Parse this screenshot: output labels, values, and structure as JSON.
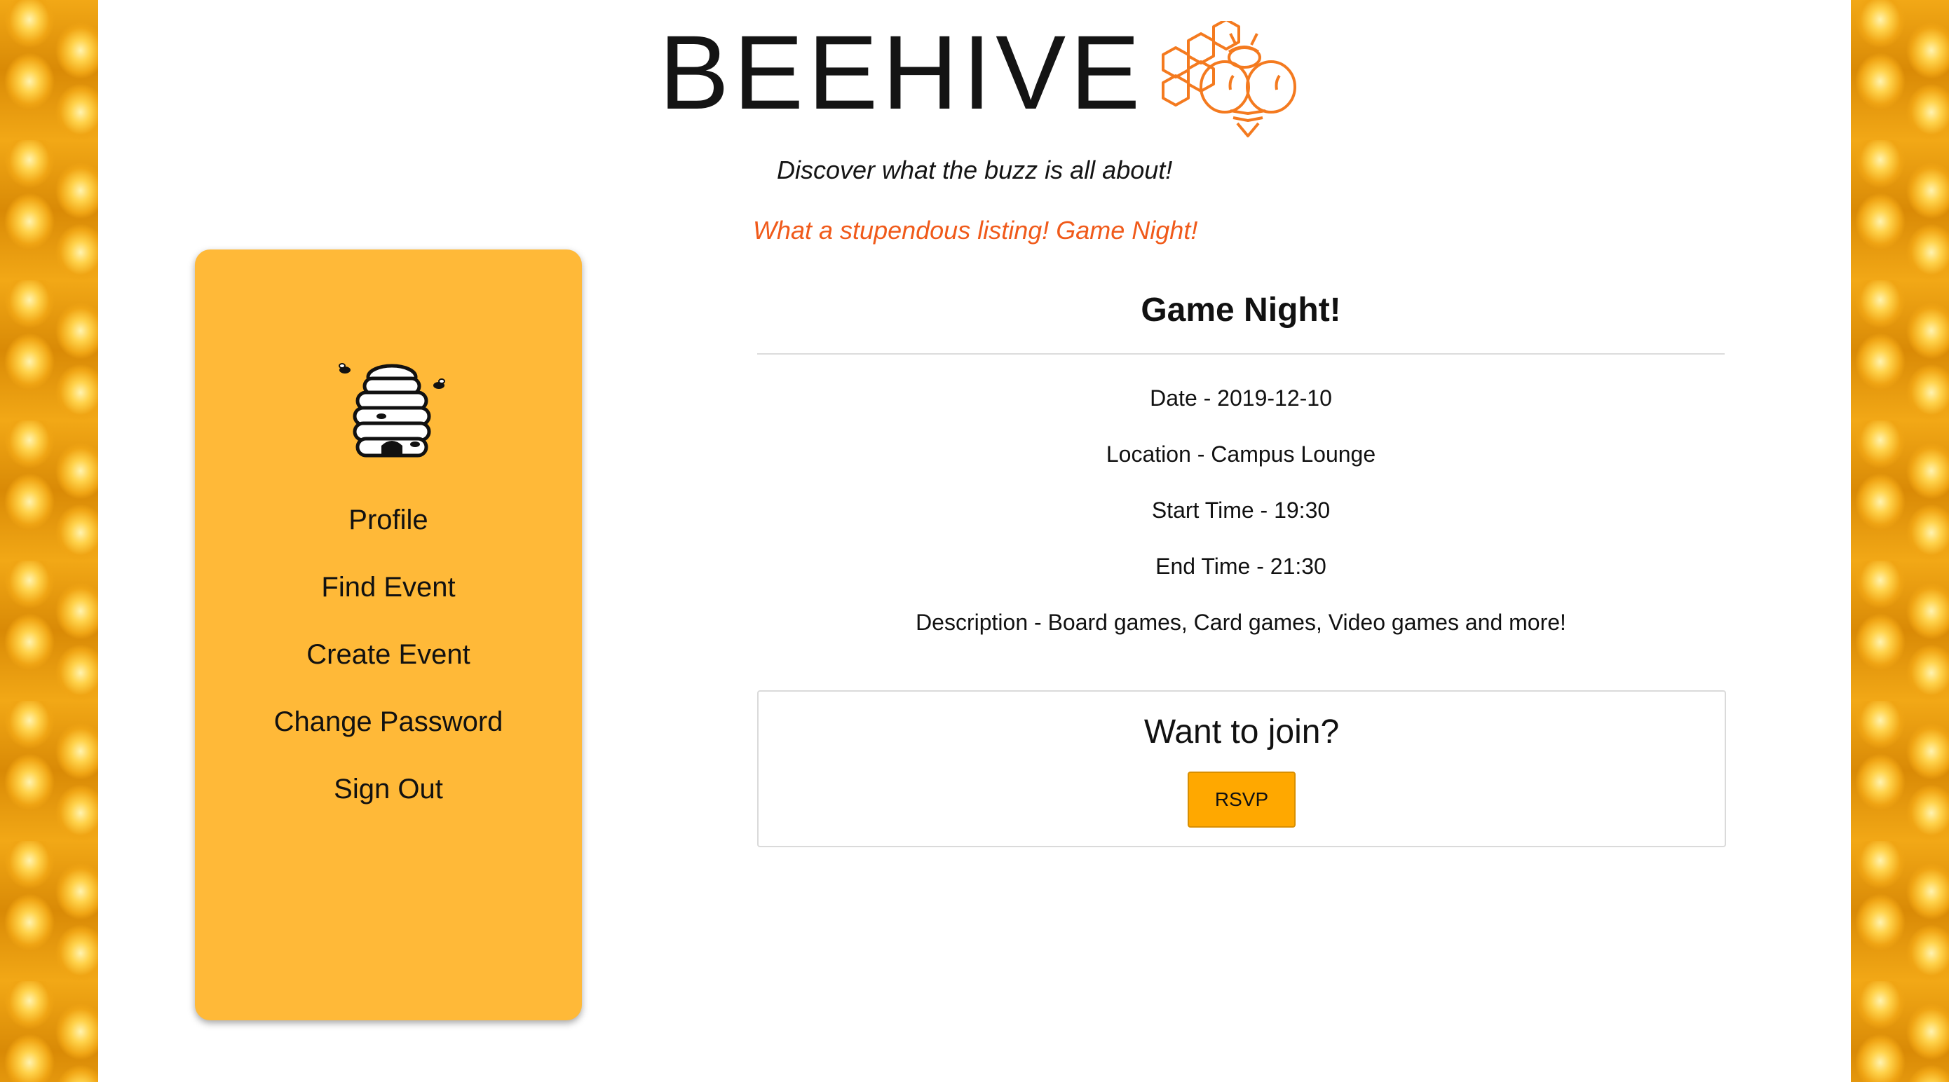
{
  "header": {
    "brand_title": "BEEHIVE",
    "logo_icon": "honeycomb-bee-icon",
    "tagline": "Discover what the buzz is all about!",
    "flash_message": "What a stupendous listing! Game Night!"
  },
  "sidebar": {
    "logo_icon": "beehive-icon",
    "items": [
      {
        "label": "Profile"
      },
      {
        "label": "Find Event"
      },
      {
        "label": "Create Event"
      },
      {
        "label": "Change Password"
      },
      {
        "label": "Sign Out"
      }
    ]
  },
  "event": {
    "title": "Game Night!",
    "date": "Date - 2019-12-10",
    "location": "Location - Campus Lounge",
    "start_time": "Start Time - 19:30",
    "end_time": "End Time - 21:30",
    "description": "Description - Board games, Card games, Video games and more!"
  },
  "join": {
    "heading": "Want to join?",
    "button_label": "RSVP"
  },
  "colors": {
    "sidebar_bg": "#ffb938",
    "rsvp_bg": "#ffa800",
    "flash_text": "#f05a1a",
    "logo_accent": "#f47a1f"
  }
}
